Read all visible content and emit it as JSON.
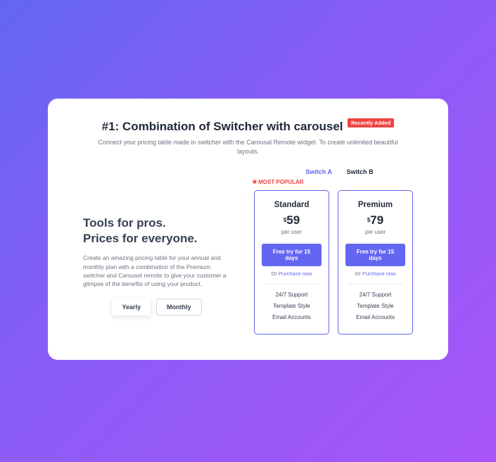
{
  "header": {
    "title": "#1: Combination of Switcher with carousel",
    "badge": "Recently Added",
    "subtitle": "Connect your pricing table made in switcher with the Carousal Remote widget. To create unlimited beautiful layouts."
  },
  "switcher": {
    "a": "Switch A",
    "b": "Switch B"
  },
  "popular": {
    "label": "MOST POPULAR"
  },
  "left": {
    "heading1": "Tools for pros.",
    "heading2": "Prices for everyone.",
    "desc": "Create an amazing pricing table for your annual and monthly plan with a combination of the Premium switcher and Carousel remote to give your customer a glimpse of the benefits of using your product.",
    "toggle": {
      "yearly": "Yearly",
      "monthly": "Monthly"
    }
  },
  "plans": [
    {
      "name": "Standard",
      "currency": "$",
      "price": "59",
      "unit": "per user",
      "cta": "Free try for 15 days",
      "or": "Or ",
      "purchase": "Purchase now",
      "features": [
        "24/7 Support",
        "Template Style",
        "Email Accounts"
      ]
    },
    {
      "name": "Premium",
      "currency": "$",
      "price": "79",
      "unit": "per user",
      "cta": "Free try for 15 days",
      "or": "Or ",
      "purchase": "Purchase now",
      "features": [
        "24/7 Support",
        "Template Style",
        "Email Accounts"
      ]
    }
  ]
}
